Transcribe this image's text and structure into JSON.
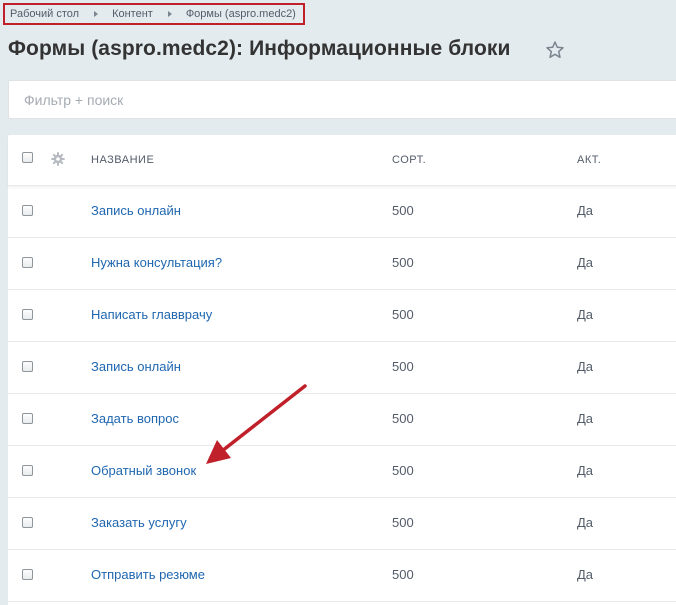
{
  "breadcrumb": {
    "items": [
      "Рабочий стол",
      "Контент",
      "Формы (aspro.medc2)"
    ]
  },
  "page": {
    "title": "Формы (aspro.medc2): Информационные блоки"
  },
  "filter": {
    "placeholder": "Фильтр + поиск",
    "value": ""
  },
  "grid": {
    "columns": {
      "name": "НАЗВАНИЕ",
      "sort": "СОРТ.",
      "active": "АКТ."
    },
    "rows": [
      {
        "name": "Запись онлайн",
        "sort": "500",
        "active": "Да"
      },
      {
        "name": "Нужна консультация?",
        "sort": "500",
        "active": "Да"
      },
      {
        "name": "Написать главврачу",
        "sort": "500",
        "active": "Да"
      },
      {
        "name": "Запись онлайн",
        "sort": "500",
        "active": "Да"
      },
      {
        "name": "Задать вопрос",
        "sort": "500",
        "active": "Да"
      },
      {
        "name": "Обратный звонок",
        "sort": "500",
        "active": "Да"
      },
      {
        "name": "Заказать услугу",
        "sort": "500",
        "active": "Да"
      },
      {
        "name": "Отправить резюме",
        "sort": "500",
        "active": "Да"
      }
    ]
  },
  "annotations": {
    "highlight_color": "#c0202a",
    "arrow_color": "#c0202a",
    "arrow_target": "Обратный звонок"
  }
}
